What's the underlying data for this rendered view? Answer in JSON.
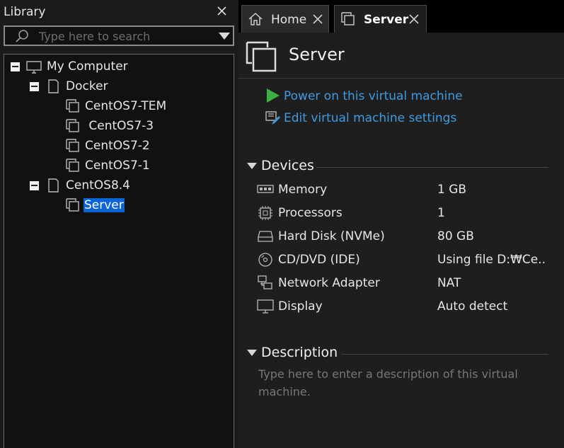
{
  "library": {
    "title": "Library",
    "search_placeholder": "Type here to search",
    "tree": [
      {
        "label": "My Computer",
        "icon": "computer-icon",
        "level": 0,
        "expanded": true
      },
      {
        "label": "Docker",
        "icon": "folder-icon",
        "level": 1,
        "expanded": true
      },
      {
        "label": "CentOS7-TEM",
        "icon": "vm-icon",
        "level": 2
      },
      {
        "label": " CentOS7-3",
        "icon": "vm-icon",
        "level": 2
      },
      {
        "label": "CentOS7-2",
        "icon": "vm-icon",
        "level": 2
      },
      {
        "label": "CentOS7-1",
        "icon": "vm-icon",
        "level": 2
      },
      {
        "label": "CentOS8.4",
        "icon": "folder-icon",
        "level": 1,
        "expanded": true
      },
      {
        "label": "Server",
        "icon": "vm-icon",
        "level": 2,
        "selected": true
      }
    ]
  },
  "tabs": [
    {
      "label": "Home",
      "icon": "home-icon",
      "active": false
    },
    {
      "label": "Server",
      "icon": "vm-icon",
      "active": true
    }
  ],
  "vm": {
    "title": "Server",
    "actions": [
      {
        "label": "Power on this virtual machine",
        "icon": "play-icon"
      },
      {
        "label": "Edit virtual machine settings",
        "icon": "settings-edit-icon"
      }
    ],
    "devices_heading": "Devices",
    "devices": [
      {
        "name": "Memory",
        "value": "1 GB",
        "icon": "memory-icon"
      },
      {
        "name": "Processors",
        "value": "1",
        "icon": "processor-icon"
      },
      {
        "name": "Hard Disk (NVMe)",
        "value": "80 GB",
        "icon": "hard-disk-icon"
      },
      {
        "name": "CD/DVD (IDE)",
        "value": "Using file D:₩Ce...",
        "icon": "cd-dvd-icon"
      },
      {
        "name": "Network Adapter",
        "value": "NAT",
        "icon": "network-adapter-icon"
      },
      {
        "name": "Display",
        "value": "Auto detect",
        "icon": "display-icon"
      }
    ],
    "description_heading": "Description",
    "description_placeholder": "Type here to enter a description of this virtual machine."
  },
  "colors": {
    "accent_link": "#3f9be0",
    "selection": "#0a64d6",
    "play": "#3cb043"
  }
}
